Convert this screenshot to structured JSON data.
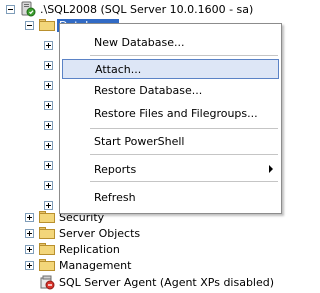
{
  "tree": {
    "server_label": ".\\SQL2008 (SQL Server 10.0.1600 - sa)",
    "databases_label": "Databases",
    "children": [
      {
        "label": "Security"
      },
      {
        "label": "Server Objects"
      },
      {
        "label": "Replication"
      },
      {
        "label": "Management"
      }
    ],
    "agent_label": "SQL Server Agent (Agent XPs disabled)"
  },
  "context_menu": {
    "items": {
      "new_database": "New Database...",
      "attach": "Attach...",
      "restore_database": "Restore Database...",
      "restore_files": "Restore Files and Filegroups...",
      "start_powershell": "Start PowerShell",
      "reports": "Reports",
      "refresh": "Refresh"
    }
  },
  "colors": {
    "selection": "#316ac5",
    "menu_hover": "#dde6f6",
    "menu_hover_border": "#5b83c6"
  }
}
